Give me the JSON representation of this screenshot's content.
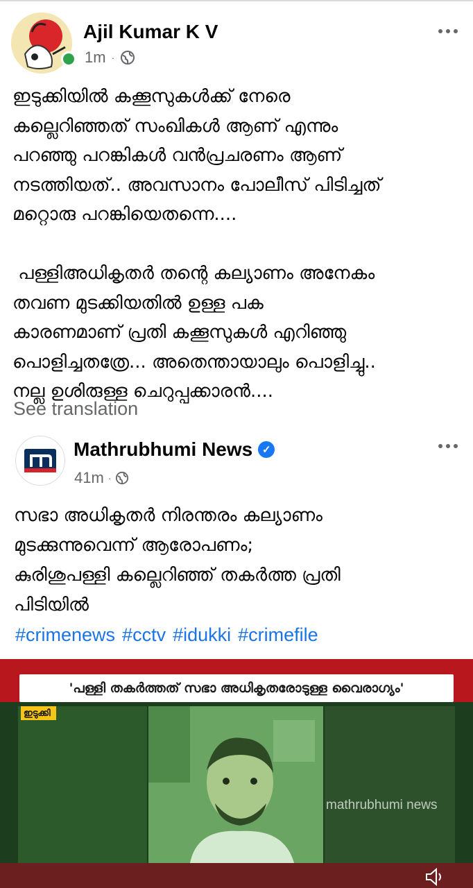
{
  "post": {
    "author": "Ajil Kumar K V",
    "time": "1m",
    "separator": "·",
    "paragraph1": [
      "ഇടുക്കിയിൽ കക്കൂസുകൾക്ക് നേരെ",
      "കല്ലെറിഞ്ഞത് സംഖികൾ ആണ് എന്നും",
      "പറഞ്ഞു പറങ്കികൾ വൻപ്രചരണം ആണ്",
      "നടത്തിയത്.. അവസാനം പോലീസ് പിടിച്ചത്",
      "മറ്റൊരു പറങ്കിയെതന്നെ...."
    ],
    "paragraph2": [
      " പള്ളിഅധികൃതർ തന്റെ കല്യാണം അനേകം",
      "തവണ മുടക്കിയതിൽ ഉള്ള പക",
      "കാരണമാണ് പ്രതി കക്കൂസുകൾ എറിഞ്ഞു",
      "പൊളിച്ചതത്രേ... അതെന്തായാലും പൊളിച്ചു..",
      "നല്ല ഉശിരുള്ള ചെറുപ്പക്കാരൻ...."
    ],
    "see_translation": "See translation"
  },
  "shared": {
    "author": "Mathrubhumi News",
    "verified_icon": "checkmark",
    "time": "41m",
    "separator": "·",
    "text": [
      "സഭാ അധികൃതർ നിരന്തരം കല്യാണം",
      "മുടക്കുന്നുവെന്ന് ആരോപണം;",
      "കുരിശുപള്ളി കല്ലെറിഞ്ഞ് തകർത്ത പ്രതി",
      "പിടിയിൽ"
    ],
    "hashtags": [
      "#crimenews",
      "#cctv",
      "#idukki",
      "#crimefile"
    ]
  },
  "video": {
    "headline": "'പള്ളി തകർത്തത് സഭാ അധികൃതരോടുള്ള വൈരാഗ്യം'",
    "location": "ഇടുക്കി",
    "watermark": "mathrubhumi news"
  },
  "colors": {
    "link": "#1b74e4",
    "meta": "#65676b",
    "online": "#31a24c",
    "verified": "#1877f2",
    "news_red": "#b8171d"
  }
}
